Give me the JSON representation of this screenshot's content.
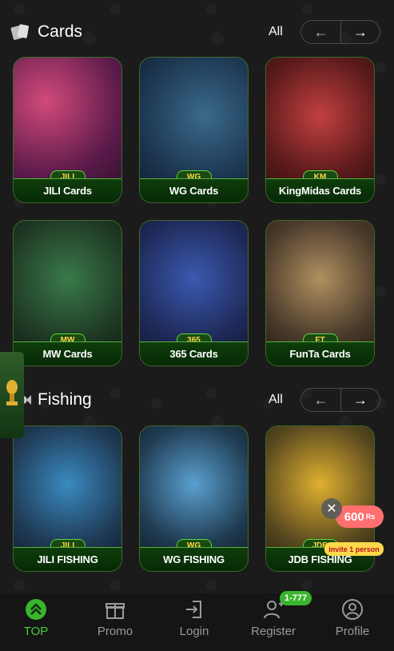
{
  "sections": [
    {
      "title": "Cards",
      "icon": "cards-icon",
      "all_label": "All",
      "items": [
        {
          "label": "JILI Cards",
          "badge": "JILI",
          "theme": "#7a2a7a"
        },
        {
          "label": "WG Cards",
          "badge": "WG",
          "theme": "#2c4d6a"
        },
        {
          "label": "KingMidas Cards",
          "badge": "KM",
          "theme": "#6a2a2a"
        },
        {
          "label": "MW Cards",
          "badge": "MW",
          "theme": "#2f4a2a"
        },
        {
          "label": "365 Cards",
          "badge": "365",
          "theme": "#2a3a6a"
        },
        {
          "label": "FunTa Cards",
          "badge": "FT",
          "theme": "#4a3a2a"
        }
      ]
    },
    {
      "title": "Fishing",
      "icon": "fishing-icon",
      "all_label": "All",
      "items": [
        {
          "label": "JILI FISHING",
          "badge": "JILI",
          "theme": "#1f3a55"
        },
        {
          "label": "WG FISHING",
          "badge": "WG",
          "theme": "#1f3a4f"
        },
        {
          "label": "JDB FISHING",
          "badge": "JDB",
          "theme": "#1f3040"
        }
      ]
    }
  ],
  "bottom_nav": [
    {
      "label": "TOP",
      "icon": "top-arrow-icon",
      "active": true
    },
    {
      "label": "Promo",
      "icon": "gift-icon",
      "active": false
    },
    {
      "label": "Login",
      "icon": "login-icon",
      "active": false
    },
    {
      "label": "Register",
      "icon": "add-user-icon",
      "active": false
    },
    {
      "label": "Profile",
      "icon": "profile-icon",
      "active": false
    }
  ],
  "register_badge": "1-777",
  "promo": {
    "amount": "600",
    "currency": "Rs",
    "invite_text": "invite 1 person"
  },
  "colors": {
    "accent_green": "#46d13b",
    "background": "#1b1b1b"
  }
}
